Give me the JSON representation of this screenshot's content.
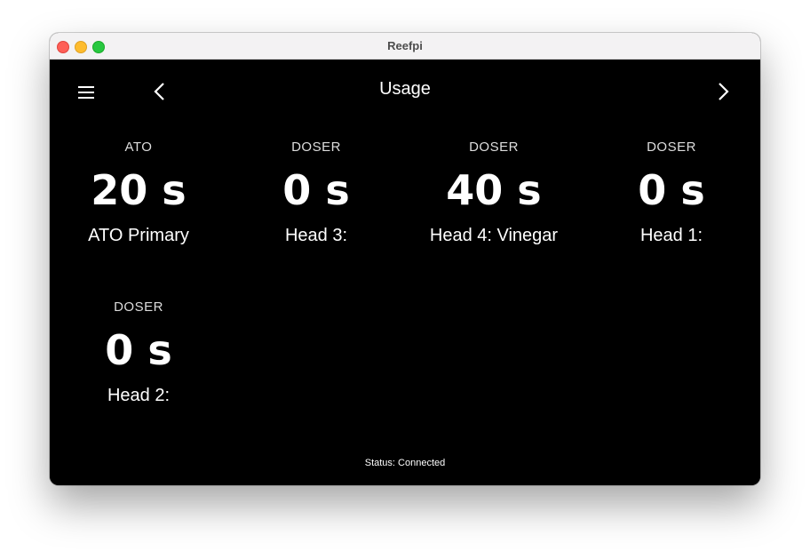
{
  "window": {
    "title": "Reefpi"
  },
  "header": {
    "title": "Usage",
    "menu_icon": "hamburger-menu-icon",
    "back_icon": "chevron-left-icon",
    "forward_icon": "chevron-right-icon"
  },
  "cards": [
    {
      "type": "ATO",
      "value": "20 s",
      "name": "ATO Primary"
    },
    {
      "type": "DOSER",
      "value": "0 s",
      "name": "Head 3:"
    },
    {
      "type": "DOSER",
      "value": "40 s",
      "name": "Head 4: Vinegar"
    },
    {
      "type": "DOSER",
      "value": "0 s",
      "name": "Head 1:"
    },
    {
      "type": "DOSER",
      "value": "0 s",
      "name": "Head 2:"
    }
  ],
  "status": {
    "text": "Status: Connected"
  },
  "colors": {
    "background": "#000000",
    "text": "#ffffff"
  }
}
